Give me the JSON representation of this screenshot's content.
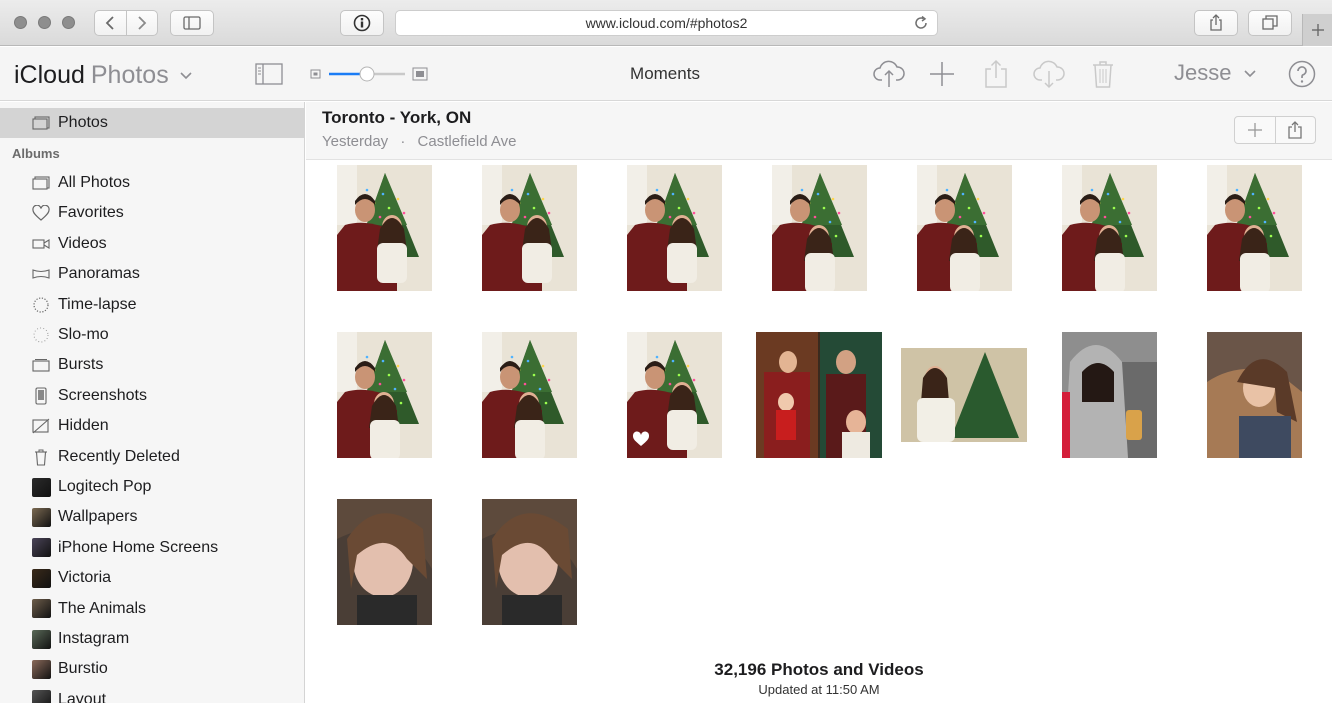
{
  "browser": {
    "url": "www.icloud.com/#photos2"
  },
  "toolbar": {
    "brand_primary": "iCloud",
    "brand_secondary": "Photos",
    "view_title": "Moments",
    "user_name": "Jesse",
    "zoom_level": 0.4
  },
  "sidebar": {
    "top_item": "Photos",
    "section_title": "Albums",
    "items": [
      {
        "label": "All Photos",
        "icon": "all-photos-icon"
      },
      {
        "label": "Favorites",
        "icon": "heart-icon"
      },
      {
        "label": "Videos",
        "icon": "video-icon"
      },
      {
        "label": "Panoramas",
        "icon": "panorama-icon"
      },
      {
        "label": "Time-lapse",
        "icon": "time-lapse-icon"
      },
      {
        "label": "Slo-mo",
        "icon": "slo-mo-icon"
      },
      {
        "label": "Bursts",
        "icon": "bursts-icon"
      },
      {
        "label": "Screenshots",
        "icon": "screenshot-icon"
      },
      {
        "label": "Hidden",
        "icon": "hidden-icon"
      },
      {
        "label": "Recently Deleted",
        "icon": "trash-icon"
      },
      {
        "label": "Logitech Pop",
        "icon": "album-thumb"
      },
      {
        "label": "Wallpapers",
        "icon": "album-thumb"
      },
      {
        "label": "iPhone Home Screens",
        "icon": "album-thumb"
      },
      {
        "label": "Victoria",
        "icon": "album-thumb"
      },
      {
        "label": "The Animals",
        "icon": "album-thumb"
      },
      {
        "label": "Instagram",
        "icon": "album-thumb"
      },
      {
        "label": "Burstio",
        "icon": "album-thumb"
      },
      {
        "label": "Layout",
        "icon": "album-thumb"
      }
    ]
  },
  "moment": {
    "title": "Toronto - York, ON",
    "date": "Yesterday",
    "separator": "·",
    "place": "Castlefield Ave"
  },
  "footer": {
    "count": "32,196 Photos and Videos",
    "updated": "Updated at 11:50 AM"
  },
  "colors": {
    "accent": "#1a7cf5",
    "toolbar_icon": "#8e8e93"
  }
}
